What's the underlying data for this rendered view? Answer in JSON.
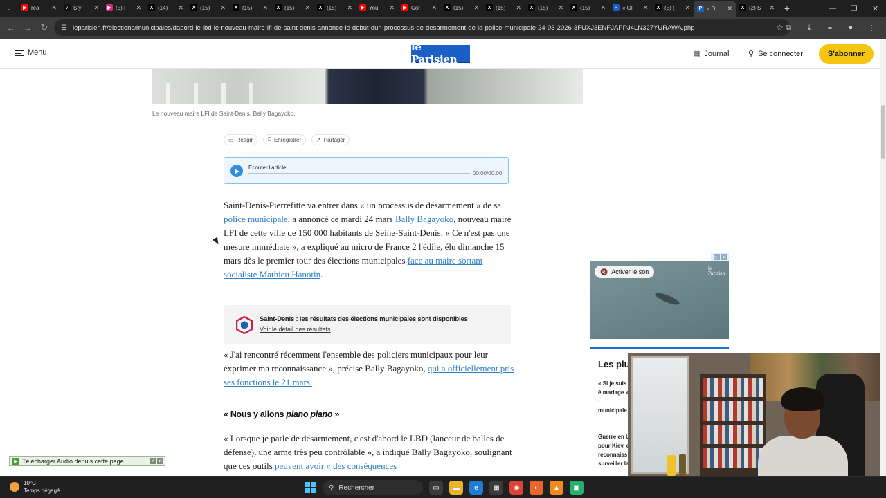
{
  "browser": {
    "tabs": [
      {
        "label": "rea",
        "icon": "youtube-icon",
        "color": "#ff0000"
      },
      {
        "label": "Styl",
        "icon": "tiktok-icon",
        "color": "#111111"
      },
      {
        "label": "(5) I",
        "icon": "instagram-icon",
        "color": "#d62976"
      },
      {
        "label": "(14)",
        "icon": "x-icon",
        "color": "#000000"
      },
      {
        "label": "(15)",
        "icon": "x-icon",
        "color": "#000000"
      },
      {
        "label": "(15)",
        "icon": "x-icon",
        "color": "#000000"
      },
      {
        "label": "(15)",
        "icon": "x-icon",
        "color": "#000000"
      },
      {
        "label": "(15)",
        "icon": "x-icon",
        "color": "#000000"
      },
      {
        "label": "You",
        "icon": "youtube-icon",
        "color": "#ff0000"
      },
      {
        "label": "Cor",
        "icon": "youtube-icon",
        "color": "#ff0000"
      },
      {
        "label": "(15)",
        "icon": "x-icon",
        "color": "#000000"
      },
      {
        "label": "(15)",
        "icon": "x-icon",
        "color": "#000000"
      },
      {
        "label": "(15)",
        "icon": "x-icon",
        "color": "#000000"
      },
      {
        "label": "(15)",
        "icon": "x-icon",
        "color": "#000000"
      },
      {
        "label": "« Ol",
        "icon": "leparisien-icon",
        "color": "#1a5fc5"
      },
      {
        "label": "(5) (",
        "icon": "x-icon",
        "color": "#000000"
      },
      {
        "label": "« D",
        "icon": "leparisien-icon",
        "color": "#1a5fc5",
        "active": true
      },
      {
        "label": "(2) S",
        "icon": "x-icon",
        "color": "#000000"
      }
    ],
    "url": "leparisien.fr/elections/municipales/dabord-le-lbd-le-nouveau-maire-lfi-de-saint-denis-annonce-le-debut-dun-processus-de-desarmement-de-la-police-municipale-24-03-2026-3FUXJ3ENFJAPPJ4LN327YURAWA.php"
  },
  "header": {
    "menu_label": "Menu",
    "logo_text": "le Parisien",
    "journal_label": "Journal",
    "connect_label": "Se connecter",
    "subscribe_label": "S'abonner"
  },
  "article": {
    "caption": "Le nouveau maire LFI de Saint-Denis. Bally Bagayoko.",
    "actions": {
      "react": "Réagir",
      "save": "Enregistrer",
      "share": "Partager"
    },
    "audio": {
      "label": "Écouter l'article",
      "time": "00:00/00:00"
    },
    "p1": {
      "t1": "Saint-Denis-Pierrefitte va entrer dans « un processus de désarmement » de sa ",
      "link1": "police municipale",
      "t2": ", a annoncé ce mardi 24 mars ",
      "link2": "Bally Bagayoko",
      "t3": ", nouveau maire LFI de cette ville de 150 000 habitants de Seine-Saint-Denis. « Ce n'est pas une mesure immédiate », a expliqué au micro de France 2 l'édile, élu dimanche 15 mars dès le premier tour des élections municipales ",
      "link3": "face au maire sortant socialiste Mathieu Hanotin",
      "t4": "."
    },
    "results": {
      "title": "Saint-Denis : les résultats des élections municipales sont disponibles",
      "link": "Voir le détail des résultats"
    },
    "p2": {
      "t1": "« J'ai rencontré récemment l'ensemble des policiers municipaux pour leur exprimer ma reconnaissance », précise Bally Bagayoko, ",
      "link1": "qui a officiellement pris ses fonctions le 21 mars."
    },
    "subhead": {
      "t1": "« Nous y allons ",
      "t2": "piano piano",
      "t3": " »"
    },
    "p3": {
      "t1": "« Lorsque je parle de désarmement, c'est d'abord le LBD (lanceur de balles de défense), une arme très peu contrôlable », a indiqué Bally Bagayoko, soulignant que ces outils ",
      "link1": "peuvent avoir « des conséquences"
    }
  },
  "sidebar": {
    "ad_sound_label": "Activer le son",
    "ad_brand": "le Parisien",
    "plus_title": "Les plus",
    "plus_item1": "« Si je suis é mariage » : municipale promesse",
    "plus_item2": "Guerre en U pour Kiev, c reconnaiss surveiller la"
  },
  "extension": {
    "label": "Télécharger Audio depuis cette page"
  },
  "taskbar": {
    "temperature": "10°C",
    "weather_text": "Temps dégagé",
    "search_label": "Rechercher"
  }
}
